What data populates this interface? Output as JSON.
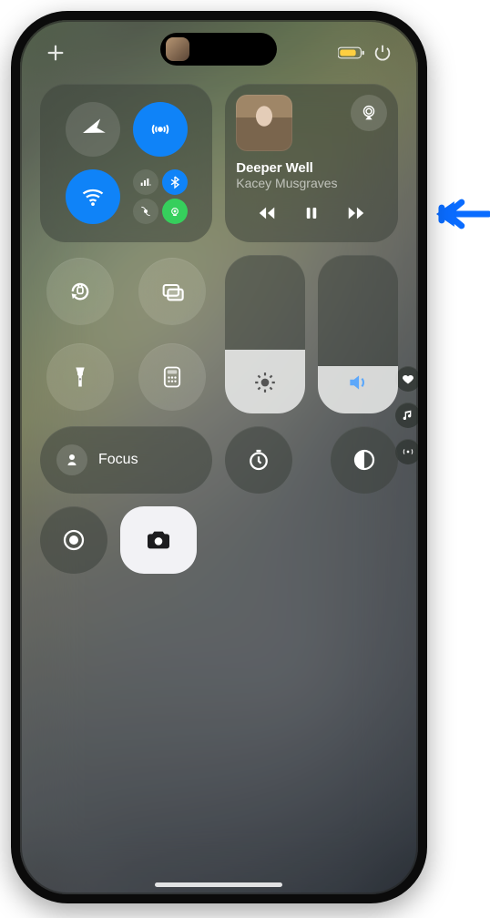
{
  "topbar": {
    "add_label": "+",
    "power_label": "Power"
  },
  "connectivity": {
    "airplane_state": "false",
    "airdrop_state": "true",
    "wifi_state": "true",
    "cellular_state": "true",
    "bluetooth_state": "true",
    "hotspot_state": "true"
  },
  "now_playing": {
    "track_title": "Deeper Well",
    "artist": "Kacey Musgraves",
    "is_playing": "false",
    "airplay_label": "AirPlay"
  },
  "utilities": {
    "rotation_lock_state": "false",
    "screen_mirror_label": "Screen Mirroring",
    "flashlight_state": "false",
    "calculator_label": "Calculator"
  },
  "sliders": {
    "brightness_pct": 40,
    "volume_pct": 30,
    "brightness_label": "Brightness",
    "volume_label": "Volume"
  },
  "focus": {
    "label": "Focus",
    "active_state": "false"
  },
  "controls": {
    "timer_label": "Timer",
    "dark_mode_label": "Dark Mode",
    "screen_record_label": "Screen Recording",
    "camera_label": "Camera"
  },
  "side_rail": {
    "dot1_icon": "heart",
    "dot2_icon": "music",
    "dot3_icon": "hotspot"
  },
  "annotation": {
    "color": "#0a6cff"
  }
}
